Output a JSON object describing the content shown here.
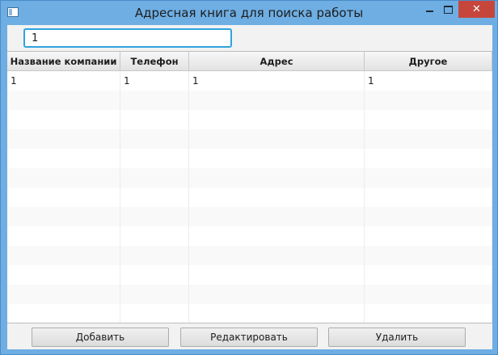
{
  "window": {
    "title": "Адресная книга для поиска работы",
    "close_glyph": "✕"
  },
  "search": {
    "value": "1"
  },
  "table": {
    "columns": [
      "Название компании",
      "Телефон",
      "Адрес",
      "Другое"
    ],
    "rows": [
      [
        "1",
        "1",
        "1",
        "1"
      ],
      [
        "",
        "",
        "",
        ""
      ],
      [
        "",
        "",
        "",
        ""
      ],
      [
        "",
        "",
        "",
        ""
      ],
      [
        "",
        "",
        "",
        ""
      ],
      [
        "",
        "",
        "",
        ""
      ],
      [
        "",
        "",
        "",
        ""
      ],
      [
        "",
        "",
        "",
        ""
      ],
      [
        "",
        "",
        "",
        ""
      ],
      [
        "",
        "",
        "",
        ""
      ],
      [
        "",
        "",
        "",
        ""
      ],
      [
        "",
        "",
        "",
        ""
      ],
      [
        "",
        "",
        "",
        ""
      ]
    ]
  },
  "buttons": {
    "add": "Добавить",
    "edit": "Редактировать",
    "delete": "Удалить"
  }
}
